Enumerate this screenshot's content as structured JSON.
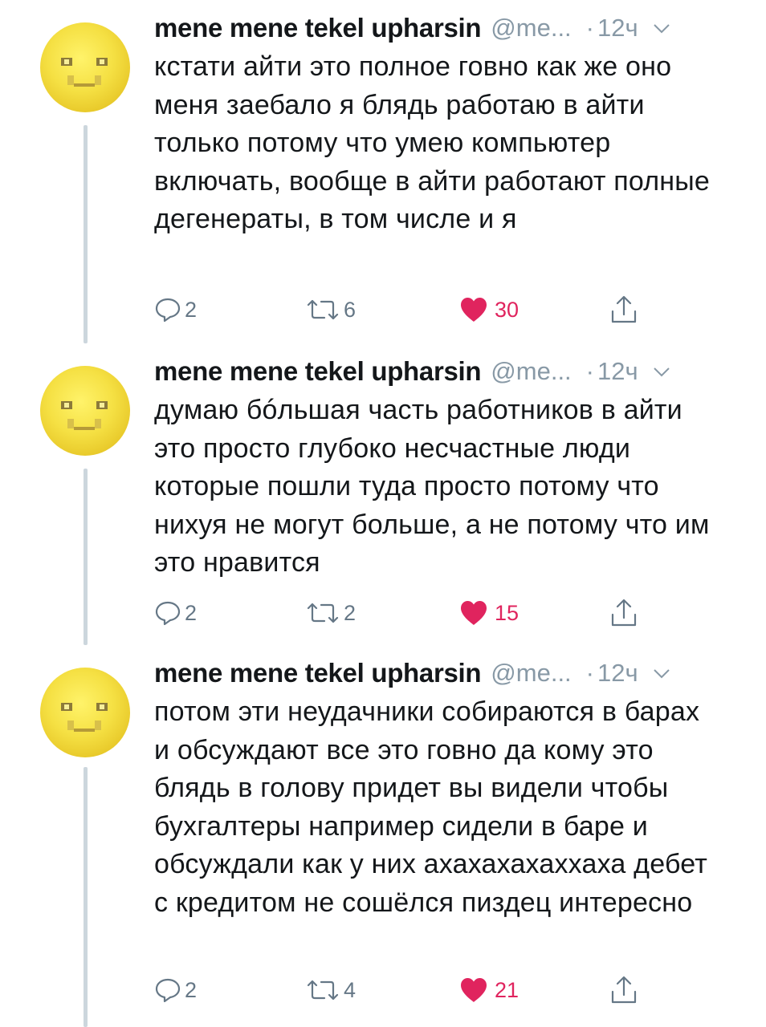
{
  "tweets": [
    {
      "author_name": "mene mene tekel upharsin",
      "handle": "@me...",
      "separator": "·",
      "time": "12ч",
      "text": "кстати айти это полное говно как же оно меня заебало я блядь работаю в айти только потому что умею компьютер включать, вообще в айти работают полные дегенераты, в том числе и я",
      "replies": "2",
      "retweets": "6",
      "likes": "30",
      "liked": true
    },
    {
      "author_name": "mene mene tekel upharsin",
      "handle": "@me...",
      "separator": "·",
      "time": "12ч",
      "text": "думаю бóльшая часть работников в айти это просто глубоко несчастные люди которые пошли туда просто потому что нихуя не могут больше, а не потому что им это нравится",
      "replies": "2",
      "retweets": "2",
      "likes": "15",
      "liked": true
    },
    {
      "author_name": "mene mene tekel upharsin",
      "handle": "@me...",
      "separator": "·",
      "time": "12ч",
      "text": "потом эти неудачники собираются в барах и обсуждают все это говно да кому это блядь в голову придет вы видели чтобы бухгалтеры например сидели в баре и обсуждали как у них ахахахахаххаха дебет с кредитом не сошёлся пиздец интересно",
      "replies": "2",
      "retweets": "4",
      "likes": "21",
      "liked": true
    }
  ],
  "colors": {
    "text": "#14171a",
    "secondary": "#8899a6",
    "action_gray": "#657786",
    "like_red": "#e0245e",
    "thread_line": "#ccd6dd"
  },
  "icons": {
    "reply": "reply-icon",
    "retweet": "retweet-icon",
    "like": "heart-icon",
    "share": "share-icon",
    "menu": "chevron-down-icon"
  }
}
